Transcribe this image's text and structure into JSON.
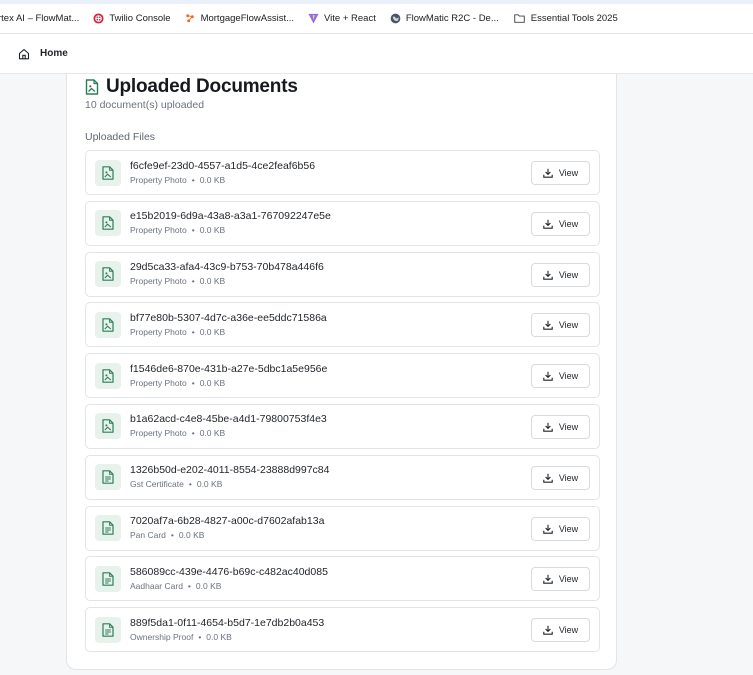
{
  "bookmarks": [
    {
      "label": "rtex AI – FlowMat...",
      "icon": "vertex-ai-icon"
    },
    {
      "label": "Twilio Console",
      "icon": "twilio-icon"
    },
    {
      "label": "MortgageFlowAssist...",
      "icon": "mortgage-flow-icon"
    },
    {
      "label": "Vite + React",
      "icon": "vite-icon"
    },
    {
      "label": "FlowMatic R2C - De...",
      "icon": "globe-icon"
    },
    {
      "label": "Essential Tools 2025",
      "icon": "folder-icon"
    }
  ],
  "header": {
    "home_label": "Home",
    "home_icon": "home-icon"
  },
  "documents": {
    "title": "Uploaded Documents",
    "subtitle": "10 document(s) uploaded",
    "section_label": "Uploaded Files",
    "view_label": "View",
    "colors": {
      "accent": "#2e7d55",
      "thumb_bg": "#e7f2ec"
    },
    "files": [
      {
        "name": "f6cfe9ef-23d0-4557-a1d5-4ce2feaf6b56",
        "type": "Property Photo",
        "size": "0.0 KB",
        "icon": "image-file-icon"
      },
      {
        "name": "e15b2019-6d9a-43a8-a3a1-767092247e5e",
        "type": "Property Photo",
        "size": "0.0 KB",
        "icon": "image-file-icon"
      },
      {
        "name": "29d5ca33-afa4-43c9-b753-70b478a446f6",
        "type": "Property Photo",
        "size": "0.0 KB",
        "icon": "image-file-icon"
      },
      {
        "name": "bf77e80b-5307-4d7c-a36e-ee5ddc71586a",
        "type": "Property Photo",
        "size": "0.0 KB",
        "icon": "image-file-icon"
      },
      {
        "name": "f1546de6-870e-431b-a27e-5dbc1a5e956e",
        "type": "Property Photo",
        "size": "0.0 KB",
        "icon": "image-file-icon"
      },
      {
        "name": "b1a62acd-c4e8-45be-a4d1-79800753f4e3",
        "type": "Property Photo",
        "size": "0.0 KB",
        "icon": "image-file-icon"
      },
      {
        "name": "1326b50d-e202-4011-8554-23888d997c84",
        "type": "Gst Certificate",
        "size": "0.0 KB",
        "icon": "text-file-icon"
      },
      {
        "name": "7020af7a-6b28-4827-a00c-d7602afab13a",
        "type": "Pan Card",
        "size": "0.0 KB",
        "icon": "text-file-icon"
      },
      {
        "name": "586089cc-439e-4476-b69c-c482ac40d085",
        "type": "Aadhaar Card",
        "size": "0.0 KB",
        "icon": "text-file-icon"
      },
      {
        "name": "889f5da1-0f11-4654-b5d7-1e7db2b0a453",
        "type": "Ownership Proof",
        "size": "0.0 KB",
        "icon": "text-file-icon"
      }
    ]
  }
}
